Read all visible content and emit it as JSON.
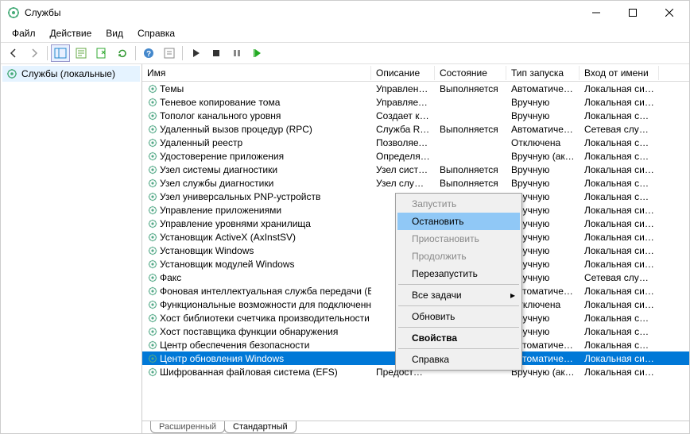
{
  "window": {
    "title": "Службы"
  },
  "menu": [
    "Файл",
    "Действие",
    "Вид",
    "Справка"
  ],
  "tree": {
    "root": "Службы (локальные)"
  },
  "columns": [
    "Имя",
    "Описание",
    "Состояние",
    "Тип запуска",
    "Вход от имени"
  ],
  "rows": [
    {
      "name": "Темы",
      "desc": "Управлен…",
      "state": "Выполняется",
      "start": "Автоматиче…",
      "logon": "Локальная сис…"
    },
    {
      "name": "Теневое копирование тома",
      "desc": "Управляет…",
      "state": "",
      "start": "Вручную",
      "logon": "Локальная сис…"
    },
    {
      "name": "Тополог канального уровня",
      "desc": "Создает ка…",
      "state": "",
      "start": "Вручную",
      "logon": "Локальная слу…"
    },
    {
      "name": "Удаленный вызов процедур (RPC)",
      "desc": "Служба R…",
      "state": "Выполняется",
      "start": "Автоматиче…",
      "logon": "Сетевая служба"
    },
    {
      "name": "Удаленный реестр",
      "desc": "Позволяет…",
      "state": "",
      "start": "Отключена",
      "logon": "Локальная слу…"
    },
    {
      "name": "Удостоверение приложения",
      "desc": "Определя…",
      "state": "",
      "start": "Вручную (ак…",
      "logon": "Локальная слу…"
    },
    {
      "name": "Узел системы диагностики",
      "desc": "Узел сист…",
      "state": "Выполняется",
      "start": "Вручную",
      "logon": "Локальная сис…"
    },
    {
      "name": "Узел службы диагностики",
      "desc": "Узел служ…",
      "state": "Выполняется",
      "start": "Вручную",
      "logon": "Локальная слу…"
    },
    {
      "name": "Узел универсальных PNP-устройств",
      "desc": "",
      "state": "",
      "start": "Вручную",
      "logon": "Локальная слу…"
    },
    {
      "name": "Управление приложениями",
      "desc": "",
      "state": "",
      "start": "Вручную",
      "logon": "Локальная сис…"
    },
    {
      "name": "Управление уровнями хранилища",
      "desc": "",
      "state": "",
      "start": "Вручную",
      "logon": "Локальная сис…"
    },
    {
      "name": "Установщик ActiveX (AxInstSV)",
      "desc": "",
      "state": "",
      "start": "Вручную",
      "logon": "Локальная сис…"
    },
    {
      "name": "Установщик Windows",
      "desc": "",
      "state": "",
      "start": "Вручную",
      "logon": "Локальная сис…"
    },
    {
      "name": "Установщик модулей Windows",
      "desc": "",
      "state": "",
      "start": "Вручную",
      "logon": "Локальная сис…"
    },
    {
      "name": "Факс",
      "desc": "",
      "state": "",
      "start": "Вручную",
      "logon": "Сетевая служба"
    },
    {
      "name": "Фоновая интеллектуальная служба передачи (BITS)",
      "desc": "",
      "state": "",
      "start": "Автоматиче…",
      "logon": "Локальная сис…"
    },
    {
      "name": "Функциональные возможности для подключенных…",
      "desc": "",
      "state": "",
      "start": "Отключена",
      "logon": "Локальная сис…"
    },
    {
      "name": "Хост библиотеки счетчика производительности",
      "desc": "",
      "state": "",
      "start": "Вручную",
      "logon": "Локальная слу…"
    },
    {
      "name": "Хост поставщика функции обнаружения",
      "desc": "",
      "state": "",
      "start": "Вручную",
      "logon": "Локальная слу…"
    },
    {
      "name": "Центр обеспечения безопасности",
      "desc": "",
      "state": "",
      "start": "Автоматиче…",
      "logon": "Локальная слу…"
    },
    {
      "name": "Центр обновления Windows",
      "desc": "",
      "state": "",
      "start": "Автоматиче…",
      "logon": "Локальная сис…",
      "selected": true
    },
    {
      "name": "Шифрованная файловая система (EFS)",
      "desc": "Предост…",
      "state": "",
      "start": "Вручную (ак…",
      "logon": "Локальная сис…"
    }
  ],
  "ctx": {
    "start": "Запустить",
    "stop": "Остановить",
    "pause": "Приостановить",
    "continue": "Продолжить",
    "restart": "Перезапустить",
    "alltasks": "Все задачи",
    "refresh": "Обновить",
    "properties": "Свойства",
    "help": "Справка"
  },
  "tabs": {
    "extended": "Расширенный",
    "standard": "Стандартный"
  }
}
